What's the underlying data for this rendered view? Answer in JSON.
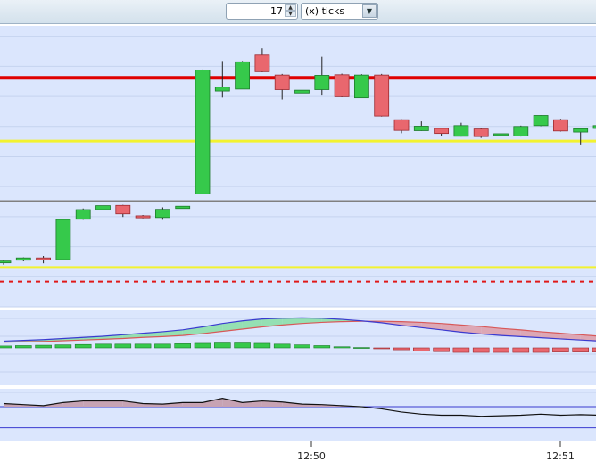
{
  "toolbar": {
    "tick_count": "17",
    "tick_unit_select": "(x) ticks"
  },
  "icons": {
    "spin_up": "spinner-up-icon",
    "spin_down": "spinner-down-icon",
    "dropdown": "chevron-down-icon"
  },
  "colors": {
    "plot_bg": "#dbe6fd",
    "bull": "#36c94b",
    "bear": "#e9676e",
    "resistance": "#e00000",
    "band": "#f2f230",
    "mid": "#808080",
    "dashed": "#e01818",
    "ma_fast": "#3a3ad0",
    "ma_slow": "#d85858"
  },
  "chart_data": [
    {
      "type": "candlestick",
      "title": "",
      "ylim": [
        0,
        100
      ],
      "x_ticks": [
        "12:50",
        "12:51"
      ],
      "candles": [
        {
          "o": 16,
          "h": 16.5,
          "l": 15,
          "c": 16.3
        },
        {
          "o": 16.6,
          "h": 17.6,
          "l": 16.2,
          "c": 17.4
        },
        {
          "o": 17.4,
          "h": 18.1,
          "l": 15.5,
          "c": 16.8
        },
        {
          "o": 16.8,
          "h": 31.2,
          "l": 16.8,
          "c": 31.1
        },
        {
          "o": 31.2,
          "h": 35.0,
          "l": 31.0,
          "c": 34.6
        },
        {
          "o": 34.6,
          "h": 37.2,
          "l": 34.3,
          "c": 36.0
        },
        {
          "o": 36.1,
          "h": 36.3,
          "l": 32.0,
          "c": 33.1
        },
        {
          "o": 32.4,
          "h": 32.7,
          "l": 31.5,
          "c": 31.7
        },
        {
          "o": 31.8,
          "h": 35.4,
          "l": 31.0,
          "c": 34.7
        },
        {
          "o": 35.0,
          "h": 35.3,
          "l": 35.0,
          "c": 35.8
        },
        {
          "o": 40.2,
          "h": 84.5,
          "l": 40.2,
          "c": 84.3
        },
        {
          "o": 76.8,
          "h": 87.5,
          "l": 74.5,
          "c": 78.2
        },
        {
          "o": 77.5,
          "h": 87.5,
          "l": 77.5,
          "c": 87.2
        },
        {
          "o": 89.6,
          "h": 92.0,
          "l": 83.5,
          "c": 83.7
        },
        {
          "o": 82.5,
          "h": 82.9,
          "l": 73.8,
          "c": 77.3
        },
        {
          "o": 76.1,
          "h": 77.5,
          "l": 71.7,
          "c": 77.1
        },
        {
          "o": 77.3,
          "h": 89.0,
          "l": 75.2,
          "c": 82.4
        },
        {
          "o": 82.6,
          "h": 83.0,
          "l": 74.6,
          "c": 74.8
        },
        {
          "o": 74.4,
          "h": 82.8,
          "l": 74.4,
          "c": 82.5
        },
        {
          "o": 82.5,
          "h": 82.9,
          "l": 67.7,
          "c": 67.9
        },
        {
          "o": 66.6,
          "h": 66.8,
          "l": 61.8,
          "c": 62.8
        },
        {
          "o": 62.7,
          "h": 66.0,
          "l": 62.6,
          "c": 64.3
        },
        {
          "o": 63.5,
          "h": 63.7,
          "l": 60.8,
          "c": 61.7
        },
        {
          "o": 60.7,
          "h": 65.5,
          "l": 60.6,
          "c": 64.5
        },
        {
          "o": 63.3,
          "h": 63.6,
          "l": 60.1,
          "c": 60.6
        },
        {
          "o": 61.0,
          "h": 62.2,
          "l": 60.1,
          "c": 61.6
        },
        {
          "o": 60.8,
          "h": 64.5,
          "l": 60.6,
          "c": 64.2
        },
        {
          "o": 64.5,
          "h": 68.2,
          "l": 64.3,
          "c": 68.1
        },
        {
          "o": 66.6,
          "h": 66.9,
          "l": 62.4,
          "c": 62.6
        },
        {
          "o": 62.2,
          "h": 63.8,
          "l": 57.5,
          "c": 63.4
        },
        {
          "o": 63.5,
          "h": 66.5,
          "l": 61.0,
          "c": 64.5
        }
      ],
      "levels": [
        {
          "y": 81.5,
          "kind": "resistance"
        },
        {
          "y": 59.0,
          "kind": "band"
        },
        {
          "y": 37.6,
          "kind": "mid"
        },
        {
          "y": 14.0,
          "kind": "band"
        },
        {
          "y": 9.0,
          "kind": "dashed"
        }
      ]
    },
    {
      "type": "oscillator",
      "title": "",
      "ylim": [
        -1,
        1
      ],
      "fast": [
        0.18,
        0.2,
        0.22,
        0.25,
        0.28,
        0.31,
        0.35,
        0.39,
        0.43,
        0.48,
        0.56,
        0.65,
        0.72,
        0.77,
        0.79,
        0.8,
        0.79,
        0.76,
        0.72,
        0.67,
        0.6,
        0.54,
        0.48,
        0.42,
        0.37,
        0.33,
        0.3,
        0.27,
        0.24,
        0.21,
        0.18
      ],
      "slow": [
        0.15,
        0.16,
        0.17,
        0.19,
        0.21,
        0.23,
        0.25,
        0.28,
        0.3,
        0.33,
        0.38,
        0.44,
        0.5,
        0.56,
        0.61,
        0.65,
        0.68,
        0.7,
        0.71,
        0.71,
        0.7,
        0.68,
        0.65,
        0.61,
        0.57,
        0.52,
        0.48,
        0.43,
        0.39,
        0.35,
        0.31
      ],
      "histogram": [
        0.05,
        0.06,
        0.07,
        0.08,
        0.09,
        0.1,
        0.1,
        0.1,
        0.1,
        0.11,
        0.12,
        0.13,
        0.13,
        0.12,
        0.1,
        0.08,
        0.06,
        0.03,
        0.01,
        -0.01,
        -0.05,
        -0.08,
        -0.1,
        -0.12,
        -0.12,
        -0.12,
        -0.12,
        -0.12,
        -0.11,
        -0.11,
        -0.11
      ]
    },
    {
      "type": "line",
      "title": "",
      "ylim": [
        0,
        1
      ],
      "values": [
        0.72,
        0.7,
        0.68,
        0.74,
        0.77,
        0.77,
        0.77,
        0.72,
        0.71,
        0.74,
        0.74,
        0.82,
        0.74,
        0.77,
        0.75,
        0.71,
        0.7,
        0.68,
        0.66,
        0.62,
        0.56,
        0.52,
        0.5,
        0.5,
        0.48,
        0.49,
        0.5,
        0.52,
        0.5,
        0.51,
        0.5
      ],
      "reference_lines": [
        0.66,
        0.26
      ]
    }
  ]
}
